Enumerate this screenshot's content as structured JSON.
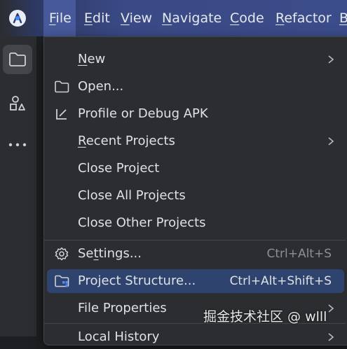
{
  "menubar": {
    "items": [
      {
        "label": "File",
        "mnemonic": "F",
        "rest": "ile"
      },
      {
        "label": "Edit",
        "mnemonic": "E",
        "rest": "dit"
      },
      {
        "label": "View",
        "mnemonic": "V",
        "rest": "iew"
      },
      {
        "label": "Navigate",
        "mnemonic": "N",
        "rest": "avigate"
      },
      {
        "label": "Code",
        "mnemonic": "C",
        "rest": "ode"
      },
      {
        "label": "Refactor",
        "mnemonic": "R",
        "rest": "efactor"
      },
      {
        "label": "B",
        "mnemonic": "B",
        "rest": ""
      }
    ],
    "active_index": 0,
    "accent": "#3b4c8a"
  },
  "left_strip": {
    "buttons": [
      {
        "icon": "folder-icon",
        "selected": true
      },
      {
        "icon": "shapes-icon",
        "selected": false
      },
      {
        "icon": "more-icon",
        "selected": false
      }
    ]
  },
  "file_menu": {
    "items": [
      {
        "pre": "",
        "mn": "N",
        "post": "ew",
        "shortcut": "",
        "submenu": true,
        "icon": ""
      },
      {
        "pre": "",
        "mn": "",
        "post": "Open...",
        "shortcut": "",
        "submenu": false,
        "icon": "folder-open-icon"
      },
      {
        "pre": "",
        "mn": "",
        "post": "Profile or Debug APK",
        "shortcut": "",
        "submenu": false,
        "icon": "profile-apk-icon"
      },
      {
        "pre": "",
        "mn": "R",
        "post": "ecent Projects",
        "shortcut": "",
        "submenu": true,
        "icon": ""
      },
      {
        "pre": "",
        "mn": "",
        "post": "Close Project",
        "shortcut": "",
        "submenu": false,
        "icon": ""
      },
      {
        "pre": "",
        "mn": "",
        "post": "Close All Projects",
        "shortcut": "",
        "submenu": false,
        "icon": ""
      },
      {
        "pre": "",
        "mn": "",
        "post": "Close Other Projects",
        "shortcut": "",
        "submenu": false,
        "icon": ""
      },
      {
        "pre": "Se",
        "mn": "t",
        "post": "tings...",
        "shortcut": "Ctrl+Alt+S",
        "submenu": false,
        "icon": "gear-icon"
      },
      {
        "pre": "",
        "mn": "",
        "post": "Project Structure...",
        "shortcut": "Ctrl+Alt+Shift+S",
        "submenu": false,
        "icon": "project-structure-icon"
      },
      {
        "pre": "",
        "mn": "",
        "post": "File Properties",
        "shortcut": "",
        "submenu": true,
        "icon": ""
      },
      {
        "pre": "",
        "mn": "",
        "post": "Local History",
        "shortcut": "",
        "submenu": true,
        "icon": ""
      }
    ],
    "highlighted_index": 8,
    "highlight_color": "#2e436e"
  },
  "watermark": "掘金技术社区 @ wlll"
}
